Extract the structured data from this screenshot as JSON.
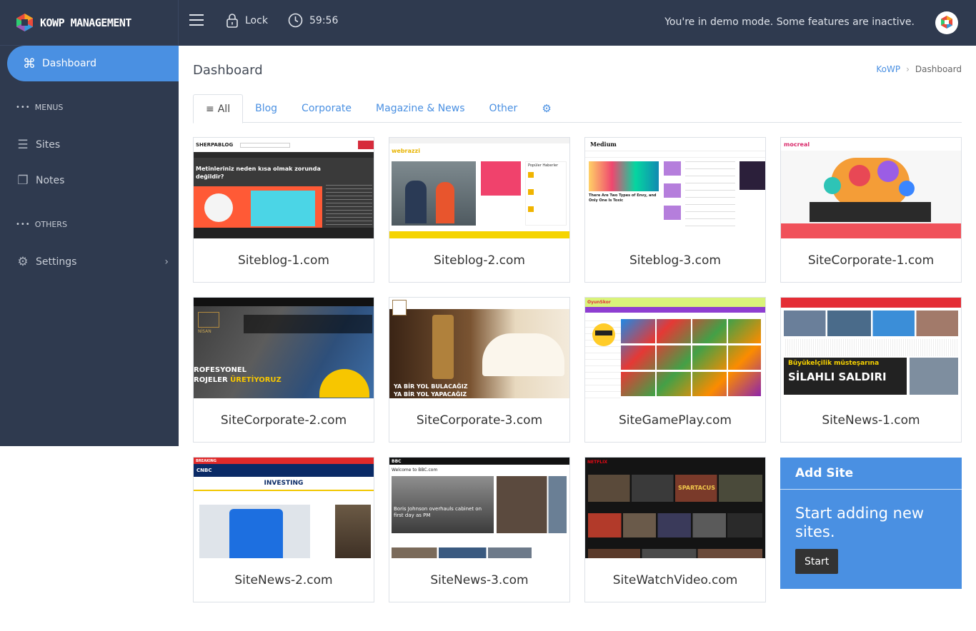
{
  "app": {
    "logo_text": "KOWP MANAGEMENT"
  },
  "topbar": {
    "lock_label": "Lock",
    "timer": "59:56",
    "demo_notice": "You're in demo mode. Some features are inactive."
  },
  "sidebar": {
    "active_item": "Dashboard",
    "menus_heading": "MENUS",
    "others_heading": "OTHERS",
    "items": [
      {
        "label": "Sites"
      },
      {
        "label": "Notes"
      },
      {
        "label": "Settings"
      }
    ]
  },
  "main": {
    "title": "Dashboard",
    "breadcrumb": {
      "root": "KoWP",
      "current": "Dashboard"
    },
    "tabs": [
      {
        "label": "All"
      },
      {
        "label": "Blog"
      },
      {
        "label": "Corporate"
      },
      {
        "label": "Magazine & News"
      },
      {
        "label": "Other"
      }
    ],
    "sites": [
      {
        "name": "Siteblog-1.com"
      },
      {
        "name": "Siteblog-2.com"
      },
      {
        "name": "Siteblog-3.com"
      },
      {
        "name": "SiteCorporate-1.com"
      },
      {
        "name": "SiteCorporate-2.com"
      },
      {
        "name": "SiteCorporate-3.com"
      },
      {
        "name": "SiteGamePlay.com"
      },
      {
        "name": "SiteNews-1.com"
      },
      {
        "name": "SiteNews-2.com"
      },
      {
        "name": "SiteNews-3.com"
      },
      {
        "name": "SiteWatchVideo.com"
      }
    ],
    "add_site": {
      "title": "Add Site",
      "body": "Start adding new sites.",
      "button": "Start"
    }
  },
  "thumbnails": {
    "t1": {
      "brand": "SHERPABLOG",
      "headline": "Metinleriniz neden kısa olmak zorunda değildir?"
    },
    "t2": {
      "brand": "webrazzi",
      "sidebar_title": "Popüler Haberler"
    },
    "t3": {
      "brand": "Medium",
      "headline": "There Are Two Types of Envy, and Only One Is Toxic"
    },
    "t4": {
      "brand": "mocreal"
    },
    "t5": {
      "brand": "NİSAN",
      "line1": "ROFESYONEL",
      "line2": "ROJELER",
      "line2b": "ÜRETİYORUZ"
    },
    "t6": {
      "line1": "YA BİR YOL BULACAĞIZ",
      "line2": "YA BİR YOL YAPACAĞIZ"
    },
    "t7": {
      "brand": "OyunSkor"
    },
    "t8": {
      "headline1": "Büyükelçilik müsteşarına",
      "headline2": "SİLAHLI SALDIRI"
    },
    "t9": {
      "brand": "CNBC",
      "section": "INVESTING",
      "breaking": "BREAKING"
    },
    "t10": {
      "brand": "BBC",
      "welcome": "Welcome to BBC.com",
      "headline": "Boris Johnson overhauls cabinet on first day as PM"
    },
    "t11": {
      "brand": "NETFLIX",
      "show": "SPARTACUS"
    }
  }
}
